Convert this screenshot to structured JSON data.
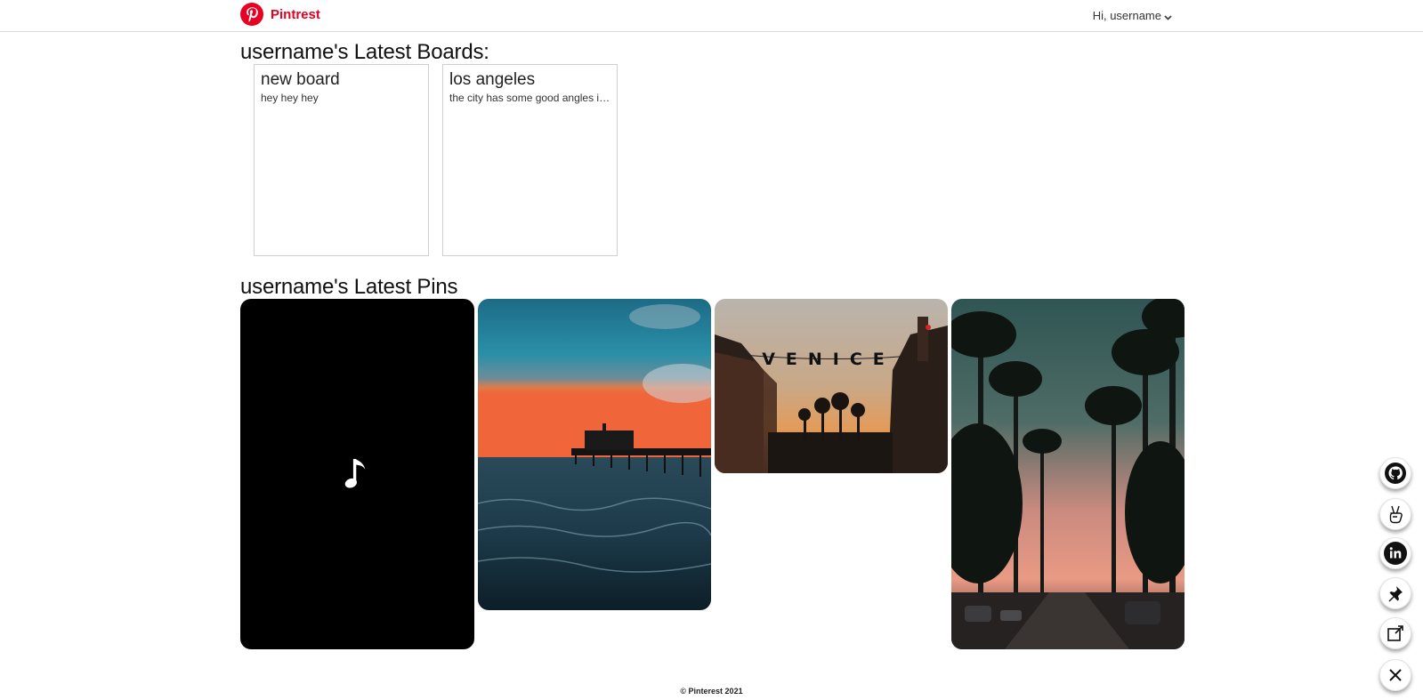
{
  "header": {
    "brand": "Pintrest",
    "user_greeting": "Hi, username",
    "brand_color": "#e60023",
    "logo_icon": "pinterest-logo-icon",
    "menu_icon": "chevron-down-icon"
  },
  "boards_section": {
    "title": "username's Latest Boards:",
    "boards": [
      {
        "name": "new board",
        "description": "hey hey hey"
      },
      {
        "name": "los angeles",
        "description": "the city has some good angles if..."
      }
    ]
  },
  "pins_section": {
    "title": "username's Latest Pins",
    "pins": [
      {
        "kind": "audio",
        "icon": "music-note-icon"
      },
      {
        "kind": "image",
        "subject": "pier at sunset over ocean"
      },
      {
        "kind": "image",
        "subject": "Venice sign over street at sunset",
        "sign_text": "VENICE"
      },
      {
        "kind": "image",
        "subject": "palm tree lined street at dusk"
      }
    ]
  },
  "footer": {
    "text": "© Pinterest 2021"
  },
  "social_links": [
    {
      "icon": "github-icon"
    },
    {
      "icon": "angellist-icon"
    },
    {
      "icon": "linkedin-icon"
    },
    {
      "icon": "pin-icon"
    },
    {
      "icon": "external-link-icon"
    },
    {
      "icon": "close-icon"
    }
  ]
}
